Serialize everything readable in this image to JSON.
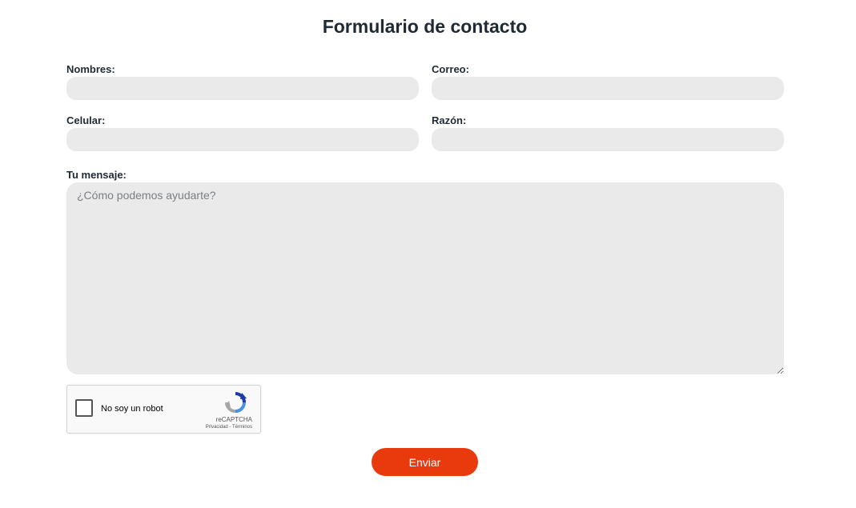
{
  "form": {
    "title": "Formulario de contacto",
    "fields": {
      "nombres": {
        "label": "Nombres:",
        "value": ""
      },
      "correo": {
        "label": "Correo:",
        "value": ""
      },
      "celular": {
        "label": "Celular:",
        "value": ""
      },
      "razon": {
        "label": "Razón:",
        "value": ""
      }
    },
    "message": {
      "label": "Tu mensaje:",
      "placeholder": "¿Cómo podemos ayudarte?"
    },
    "recaptcha": {
      "checkbox_label": "No soy un robot",
      "brand": "reCAPTCHA",
      "links": "Privacidad - Términos",
      "logo_icon": "recaptcha-logo-icon"
    },
    "submit_label": "Enviar",
    "colors": {
      "accent": "#e83a0c",
      "field_bg": "#eaeaea",
      "title": "#1f2a35"
    }
  }
}
